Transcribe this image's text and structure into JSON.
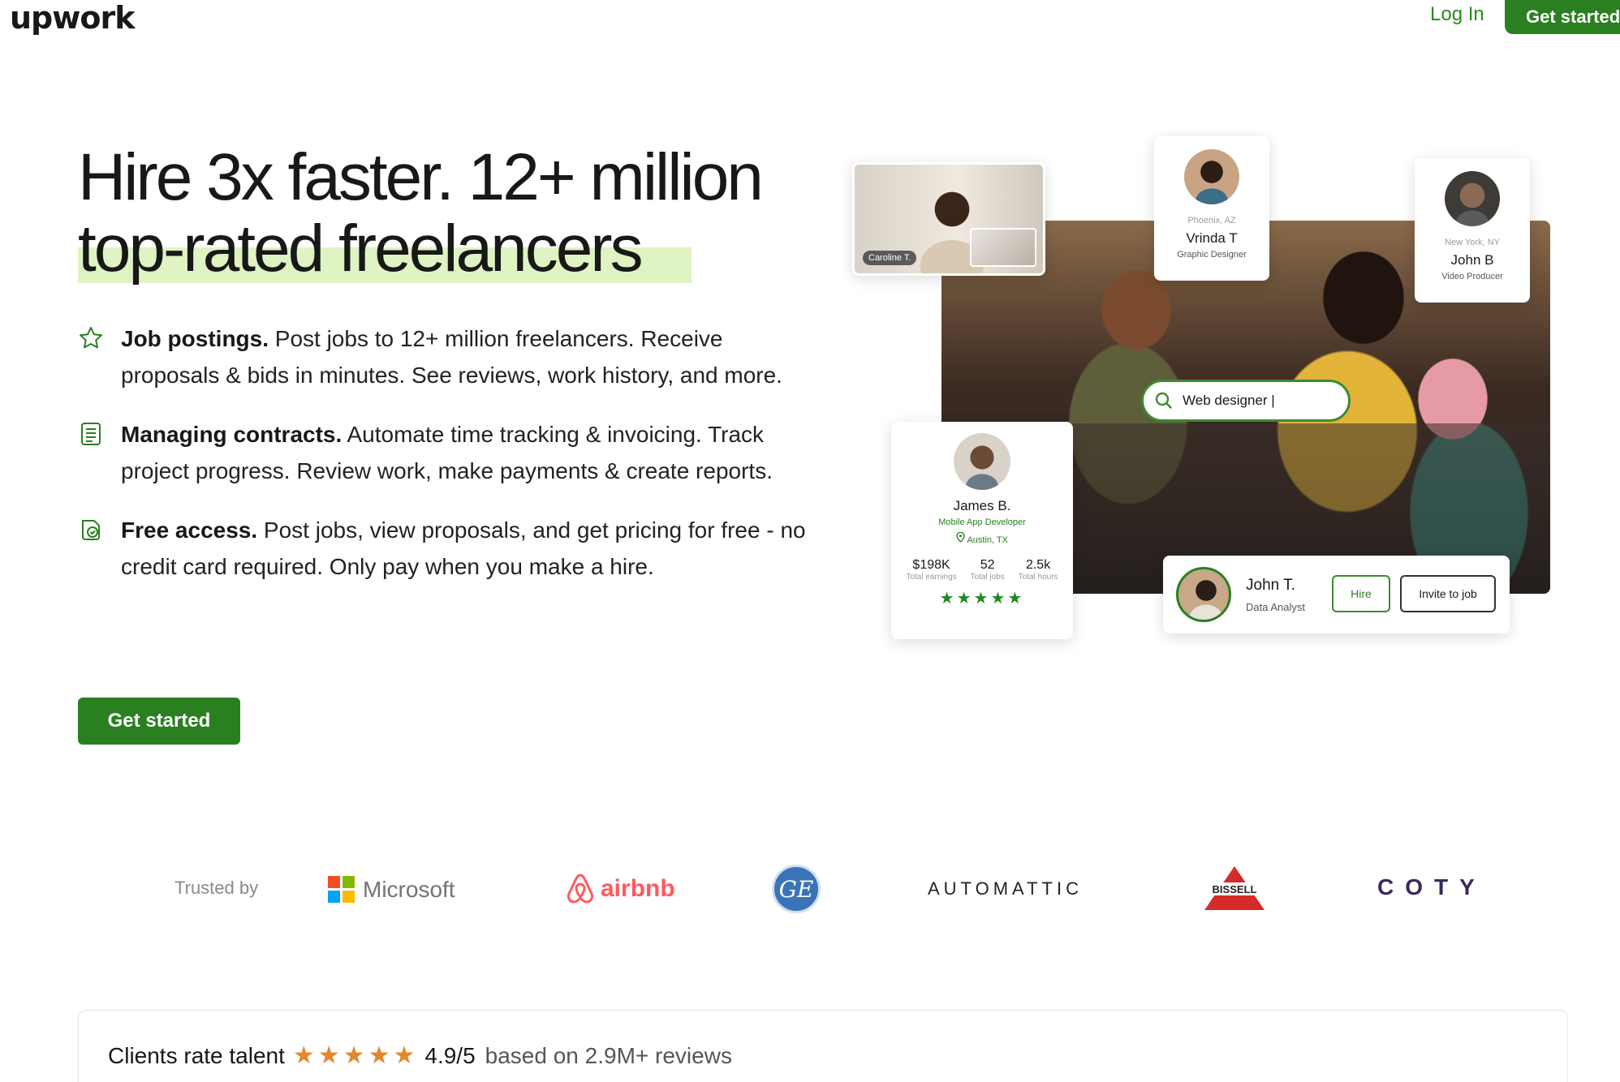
{
  "header": {
    "logo": "upwork",
    "login": "Log In",
    "cta": "Get started"
  },
  "hero": {
    "title_line1": "Hire 3x faster. 12+ million",
    "title_line2": "top-rated freelancers",
    "features": [
      {
        "icon": "star-outline-icon",
        "bold": "Job postings.",
        "text": " Post jobs to 12+ million freelancers. Receive proposals & bids in minutes. See reviews, work history, and more."
      },
      {
        "icon": "document-list-icon",
        "bold": "Managing contracts.",
        "text": " Automate time tracking & invoicing. Track project progress. Review work, make payments & create reports."
      },
      {
        "icon": "free-access-icon",
        "bold": "Free access.",
        "text": " Post jobs, view proposals, and get pricing for free - no credit card required. Only pay when you make a hire."
      }
    ],
    "cta": "Get started"
  },
  "collage": {
    "video_tag": "Caroline T.",
    "vrinda": {
      "location": "Phoenix, AZ",
      "name": "Vrinda T",
      "role": "Graphic Designer"
    },
    "johnb": {
      "location": "New York, NY",
      "name": "John B",
      "role": "Video Producer"
    },
    "search_text": "Web designer |",
    "james": {
      "name": "James B.",
      "role": "Mobile App Developer",
      "location": "Austin, TX",
      "stats": [
        {
          "value": "$198K",
          "label": "Total earnings"
        },
        {
          "value": "52",
          "label": "Total jobs"
        },
        {
          "value": "2.5k",
          "label": "Total hours"
        }
      ],
      "stars": "★★★★★"
    },
    "johnt": {
      "name": "John T.",
      "role": "Data Analyst",
      "hire": "Hire",
      "invite": "Invite to job"
    }
  },
  "trusted": {
    "label": "Trusted by",
    "microsoft": "Microsoft",
    "airbnb": "airbnb",
    "ge": "GE",
    "automattic": "AUTOMATTIC",
    "bissell": "BISSELL",
    "coty": "COTY"
  },
  "rating": {
    "label": "Clients rate talent",
    "stars": "★★★★★",
    "score": "4.9/5",
    "reviews": "based on 2.9M+ reviews"
  },
  "colors": {
    "brand_green": "#2a7f21",
    "highlight": "#dff3c3",
    "star_orange": "#e3882c"
  }
}
